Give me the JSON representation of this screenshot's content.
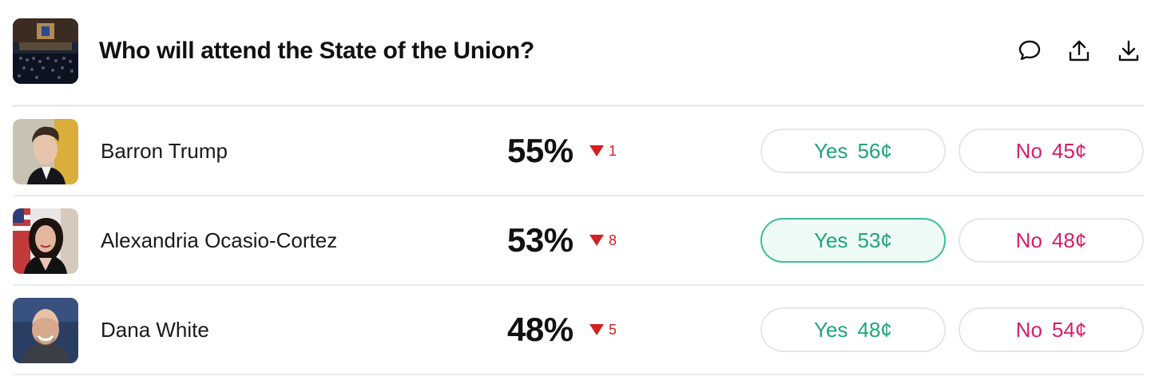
{
  "header": {
    "title": "Who will attend the State of the Union?",
    "actions": [
      {
        "icon": "comment-icon"
      },
      {
        "icon": "share-icon"
      },
      {
        "icon": "download-icon"
      }
    ]
  },
  "markets": [
    {
      "name": "Barron Trump",
      "probability": "55%",
      "change": "1",
      "change_direction": "down",
      "yes": {
        "label": "Yes",
        "price": "56¢"
      },
      "no": {
        "label": "No",
        "price": "45¢"
      },
      "selected": "none"
    },
    {
      "name": "Alexandria Ocasio-Cortez",
      "probability": "53%",
      "change": "8",
      "change_direction": "down",
      "yes": {
        "label": "Yes",
        "price": "53¢"
      },
      "no": {
        "label": "No",
        "price": "48¢"
      },
      "selected": "yes"
    },
    {
      "name": "Dana White",
      "probability": "48%",
      "change": "5",
      "change_direction": "down",
      "yes": {
        "label": "Yes",
        "price": "48¢"
      },
      "no": {
        "label": "No",
        "price": "54¢"
      },
      "selected": "none"
    }
  ],
  "colors": {
    "yes": "#1fa57a",
    "no": "#d61f66",
    "change_down": "#d32020",
    "divider": "#ececec"
  }
}
